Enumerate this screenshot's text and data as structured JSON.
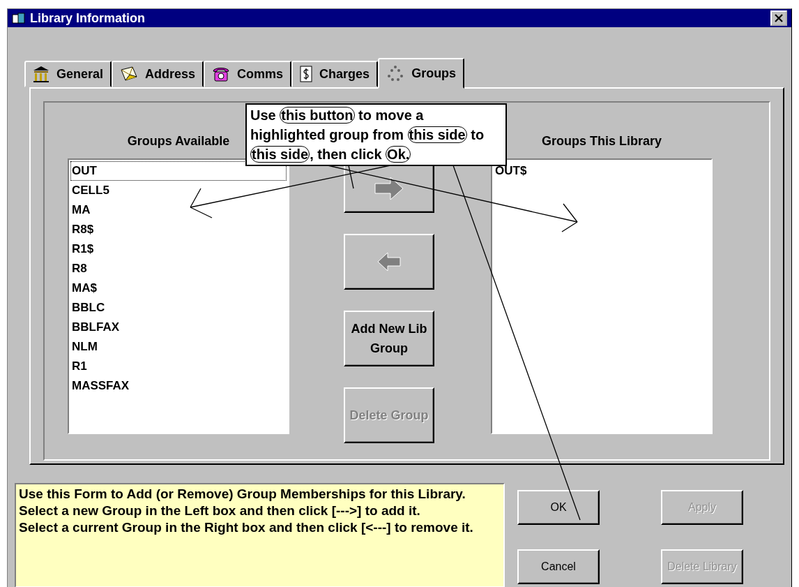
{
  "window": {
    "title": "Library Information"
  },
  "tabs": [
    {
      "label": "General",
      "selected": false
    },
    {
      "label": "Address",
      "selected": false
    },
    {
      "label": "Comms",
      "selected": false
    },
    {
      "label": "Charges",
      "selected": false
    },
    {
      "label": "Groups",
      "selected": true
    }
  ],
  "available": {
    "heading": "Groups Available",
    "items": [
      {
        "label": "OUT",
        "selected": true
      },
      {
        "label": "CELL5",
        "selected": false
      },
      {
        "label": "MA",
        "selected": false
      },
      {
        "label": "R8$",
        "selected": false
      },
      {
        "label": "R1$",
        "selected": false
      },
      {
        "label": "R8",
        "selected": false
      },
      {
        "label": "MA$",
        "selected": false
      },
      {
        "label": "BBLC",
        "selected": false
      },
      {
        "label": "BBLFAX",
        "selected": false
      },
      {
        "label": "NLM",
        "selected": false
      },
      {
        "label": "R1",
        "selected": false
      },
      {
        "label": "MASSFAX",
        "selected": false
      }
    ]
  },
  "middle_buttons": [
    {
      "kind": "arrow-right",
      "disabled": false
    },
    {
      "kind": "arrow-left",
      "disabled": false
    },
    {
      "kind": "text",
      "label": "Add New Lib Group",
      "disabled": false
    },
    {
      "kind": "text",
      "label": "Delete Group",
      "disabled": true
    }
  ],
  "library": {
    "heading": "Groups This Library",
    "items": [
      {
        "label": "OUT$",
        "selected": false
      }
    ]
  },
  "callout": {
    "segments": [
      {
        "text": "Use ",
        "ringed": false
      },
      {
        "text": "this button",
        "ringed": true
      },
      {
        "text": " to move a highlighted group from ",
        "ringed": false
      },
      {
        "text": "this side",
        "ringed": true
      },
      {
        "text": " to ",
        "ringed": false
      },
      {
        "text": "this side",
        "ringed": true
      },
      {
        "text": ", then click ",
        "ringed": false
      },
      {
        "text": "Ok.",
        "ringed": true
      }
    ]
  },
  "help": [
    "Use this Form to Add (or Remove) Group Memberships for this Library.",
    "Select a new Group in the Left box and then click [--->] to add it.",
    "Select a current Group in the Right box and then click [<---] to remove it."
  ],
  "buttons": [
    {
      "label": "OK",
      "disabled": false
    },
    {
      "label": "Apply",
      "disabled": true
    },
    {
      "label": "Cancel",
      "disabled": false
    },
    {
      "label": "Delete Library",
      "disabled": true
    }
  ]
}
